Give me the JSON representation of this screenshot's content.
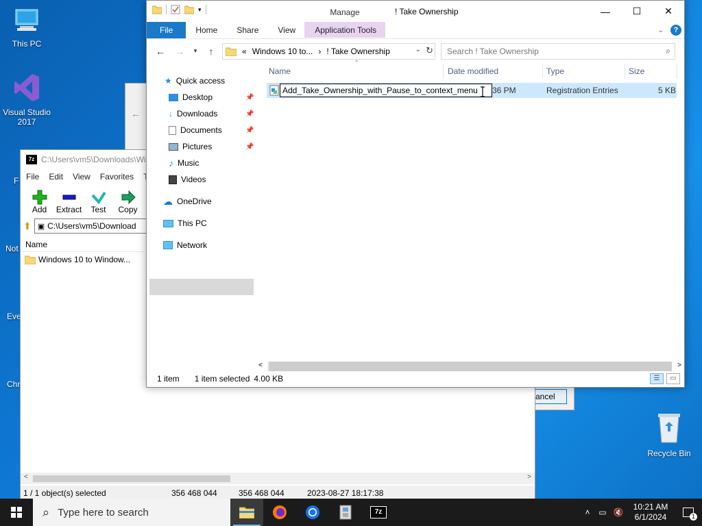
{
  "desktop": {
    "icons": [
      {
        "label": "This PC"
      },
      {
        "label": "Visual Studio 2017"
      }
    ],
    "partial_labels": [
      "F",
      "Not",
      "Eve",
      "Chr"
    ],
    "recycle_bin": "Recycle Bin"
  },
  "background_dialog": {
    "cancel_label": "ancel"
  },
  "zip_window": {
    "title": "C:\\Users\\vm5\\Downloads\\Wi",
    "menu": [
      "File",
      "Edit",
      "View",
      "Favorites",
      "To"
    ],
    "toolbar": [
      "Add",
      "Extract",
      "Test",
      "Copy",
      "M"
    ],
    "address": "C:\\Users\\vm5\\Download",
    "column_name": "Name",
    "row": "Windows 10 to Window...",
    "status": [
      "1 / 1 object(s) selected",
      "356 468 044",
      "356 468 044",
      "2023-08-27 18:17:38"
    ]
  },
  "explorer": {
    "title": "! Take Ownership",
    "manage_label": "Manage",
    "ribbon_tabs": [
      "File",
      "Home",
      "Share",
      "View",
      "Application Tools"
    ],
    "breadcrumb_prefix": "«",
    "breadcrumb": [
      "Windows 10 to...",
      "! Take Ownership"
    ],
    "search_placeholder": "Search ! Take Ownership",
    "nav": {
      "quick_access": "Quick access",
      "desktop": "Desktop",
      "downloads": "Downloads",
      "documents": "Documents",
      "pictures": "Pictures",
      "music": "Music",
      "videos": "Videos",
      "onedrive": "OneDrive",
      "this_pc": "This PC",
      "network": "Network"
    },
    "columns": [
      "Name",
      "Date modified",
      "Type",
      "Size"
    ],
    "file": {
      "rename_value": "Add_Take_Ownership_with_Pause_to_context_menu",
      "date_fragment": "36 PM",
      "type": "Registration Entries",
      "size": "5 KB"
    },
    "status": {
      "count": "1 item",
      "selected": "1 item selected",
      "size": "4.00 KB"
    }
  },
  "taskbar": {
    "search_placeholder": "Type here to search",
    "time": "10:21 AM",
    "date": "6/1/2024",
    "notification_count": "1"
  },
  "colors": {
    "desktop_bg": "#0e78d4",
    "accent": "#1979ca",
    "manage_tab": "#e8d3f0",
    "selection": "#cce8ff",
    "taskbar": "#1b1b1b"
  }
}
